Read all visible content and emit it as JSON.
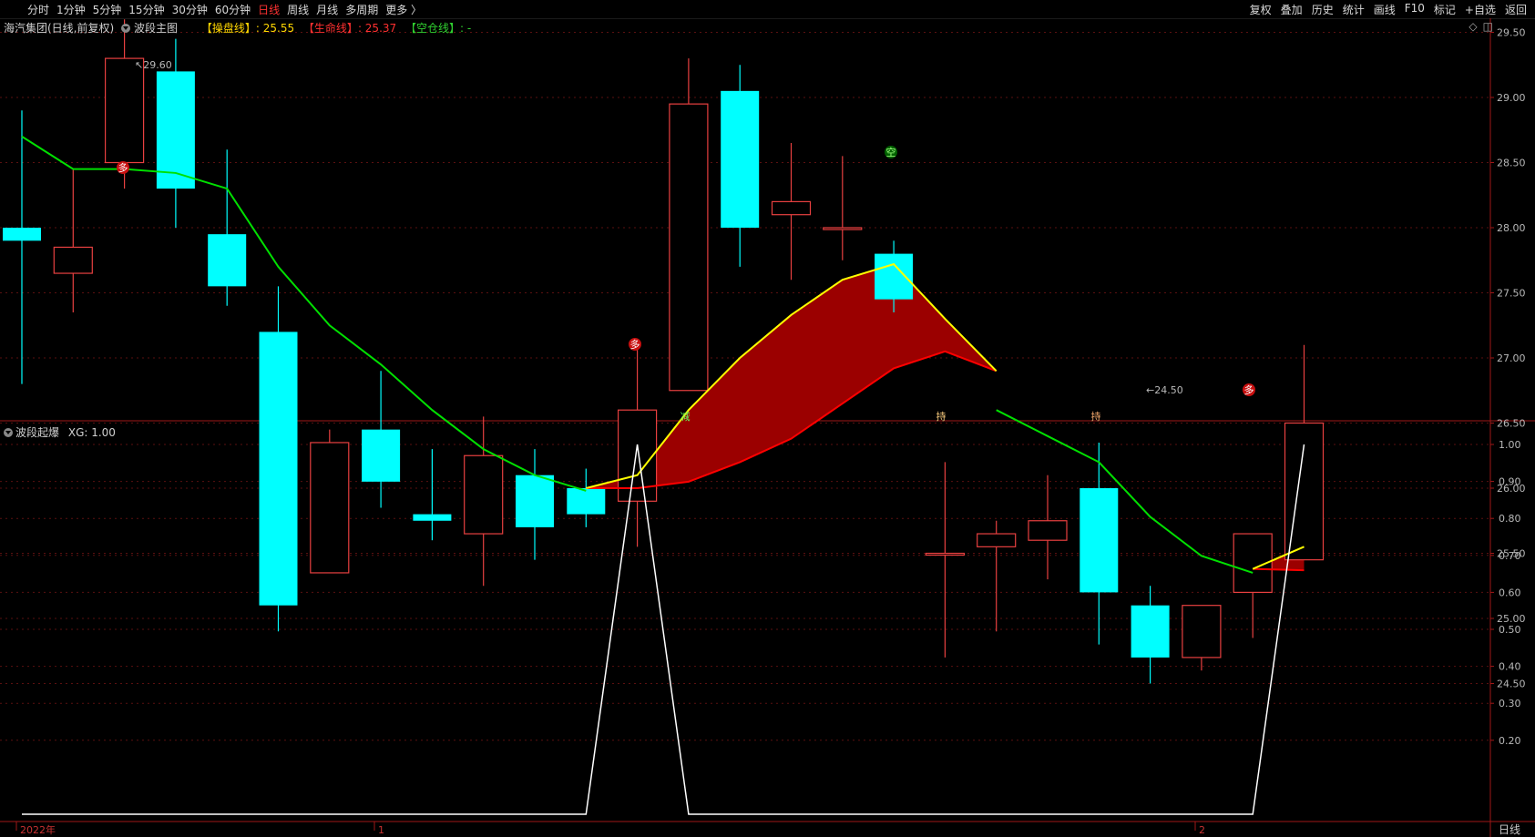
{
  "toolbar": {
    "periods": [
      "分时",
      "1分钟",
      "5分钟",
      "15分钟",
      "30分钟",
      "60分钟",
      "日线",
      "周线",
      "月线",
      "多周期",
      "更多 〉"
    ],
    "active_period": "日线",
    "tools": [
      "复权",
      "叠加",
      "历史",
      "统计",
      "画线",
      "F10",
      "标记",
      "+自选",
      "返回"
    ]
  },
  "main_panel": {
    "stock_title": "海汽集团(日线,前复权)",
    "indicator_name": "波段主图",
    "line1_label": "【操盘线】",
    "line1_value": ": 25.55",
    "line2_label": "【生命线】",
    "line2_value": ": 25.37",
    "line3_label": "【空仓线】",
    "line3_value": ": -",
    "high_marker": "29.60",
    "low_marker": "24.50",
    "y_ticks": [
      "29.50",
      "29.00",
      "28.50",
      "28.00",
      "27.50",
      "27.00",
      "26.50",
      "26.00",
      "25.50",
      "25.00",
      "24.50"
    ],
    "signals": [
      "多",
      "多",
      "空",
      "多",
      "减",
      "持",
      "持"
    ],
    "colors": {
      "up": "#e84040",
      "down": "#00ffff",
      "green_line": "#00e000",
      "yellow_line": "#ffff00",
      "red_line": "#ff0000",
      "fill": "#9b0000"
    }
  },
  "sub_panel": {
    "indicator_name": "波段起爆",
    "value_text": "XG: 1.00",
    "y_ticks": [
      "1.00",
      "0.90",
      "0.80",
      "0.70",
      "0.60",
      "0.50",
      "0.40",
      "0.30",
      "0.20"
    ]
  },
  "x_axis": {
    "labels": [
      "2022年",
      "1",
      "2"
    ]
  },
  "period_label": "日线",
  "chart_data": {
    "type": "candlestick",
    "candles": [
      {
        "o": 28.0,
        "h": 28.9,
        "l": 26.8,
        "c": 27.9
      },
      {
        "o": 27.65,
        "h": 28.45,
        "l": 27.35,
        "c": 27.85
      },
      {
        "o": 28.5,
        "h": 29.6,
        "l": 28.3,
        "c": 29.3
      },
      {
        "o": 29.2,
        "h": 29.45,
        "l": 28.0,
        "c": 28.3
      },
      {
        "o": 27.95,
        "h": 28.6,
        "l": 27.4,
        "c": 27.55
      },
      {
        "o": 27.2,
        "h": 27.55,
        "l": 24.9,
        "c": 25.1
      },
      {
        "o": 25.35,
        "h": 26.45,
        "l": 25.35,
        "c": 26.35
      },
      {
        "o": 26.45,
        "h": 26.9,
        "l": 25.85,
        "c": 26.05
      },
      {
        "o": 25.8,
        "h": 26.3,
        "l": 25.6,
        "c": 25.75
      },
      {
        "o": 25.65,
        "h": 26.55,
        "l": 25.25,
        "c": 26.25
      },
      {
        "o": 26.1,
        "h": 26.3,
        "l": 25.45,
        "c": 25.7
      },
      {
        "o": 26.0,
        "h": 26.15,
        "l": 25.7,
        "c": 25.8
      },
      {
        "o": 25.9,
        "h": 27.1,
        "l": 25.55,
        "c": 26.6
      },
      {
        "o": 26.75,
        "h": 29.3,
        "l": 26.75,
        "c": 28.95
      },
      {
        "o": 29.05,
        "h": 29.25,
        "l": 27.7,
        "c": 28.0
      },
      {
        "o": 28.1,
        "h": 28.65,
        "l": 27.6,
        "c": 28.2
      },
      {
        "o": 28.0,
        "h": 28.55,
        "l": 27.75,
        "c": 28.0
      },
      {
        "o": 27.8,
        "h": 27.9,
        "l": 27.35,
        "c": 27.45
      },
      {
        "o": 25.5,
        "h": 26.2,
        "l": 24.7,
        "c": 25.5
      },
      {
        "o": 25.55,
        "h": 25.75,
        "l": 24.9,
        "c": 25.65
      },
      {
        "o": 25.6,
        "h": 26.1,
        "l": 25.3,
        "c": 25.75
      },
      {
        "o": 26.0,
        "h": 26.35,
        "l": 24.8,
        "c": 25.2
      },
      {
        "o": 25.1,
        "h": 25.25,
        "l": 24.5,
        "c": 24.7
      },
      {
        "o": 24.7,
        "h": 25.1,
        "l": 24.6,
        "c": 25.1
      },
      {
        "o": 25.2,
        "h": 25.6,
        "l": 24.85,
        "c": 25.65
      },
      {
        "o": 25.45,
        "h": 27.1,
        "l": 25.45,
        "c": 26.5
      }
    ],
    "green_line": [
      28.7,
      28.45,
      28.45,
      28.42,
      28.3,
      27.7,
      27.25,
      26.95,
      26.6,
      26.3,
      26.1,
      25.98,
      null,
      null,
      null,
      null,
      null,
      null,
      null,
      26.6,
      26.4,
      26.2,
      25.78,
      25.48,
      25.35,
      null
    ],
    "yellow_line": [
      null,
      null,
      null,
      null,
      null,
      null,
      null,
      null,
      null,
      null,
      null,
      26.0,
      26.1,
      26.6,
      27.0,
      27.33,
      27.6,
      27.72,
      27.3,
      26.9,
      null,
      null,
      null,
      null,
      25.38,
      25.55
    ],
    "red_line": [
      null,
      null,
      null,
      null,
      null,
      null,
      null,
      null,
      null,
      null,
      null,
      26.0,
      26.0,
      26.05,
      26.2,
      26.38,
      26.65,
      26.92,
      27.05,
      26.9,
      null,
      null,
      null,
      null,
      25.38,
      25.37
    ],
    "xg": [
      0,
      0,
      0,
      0,
      0,
      0,
      0,
      0,
      0,
      0,
      0,
      0,
      1,
      0,
      0,
      0,
      0,
      0,
      0,
      0,
      0,
      0,
      0,
      0,
      0,
      1
    ]
  }
}
